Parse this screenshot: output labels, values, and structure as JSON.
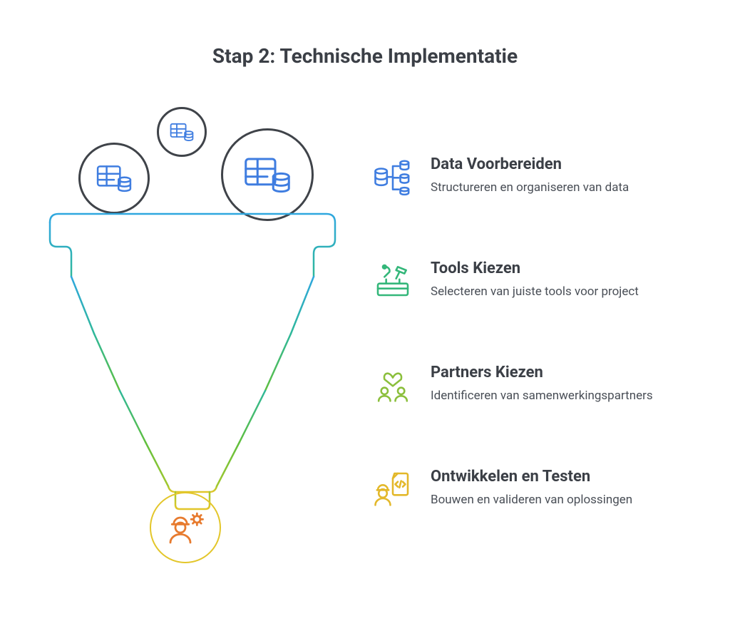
{
  "title": "Stap 2: Technische Implementatie",
  "colors": {
    "blue": "#2fa7df",
    "teal": "#2fb89a",
    "green": "#5fbf3e",
    "lime": "#a3c82f",
    "yellow": "#e3c62a",
    "iconBlue": "#3f7de0",
    "iconGreen": "#34b77a",
    "iconLime": "#8bbf3c",
    "iconYellow": "#e3b82a",
    "iconOrange": "#e77b2f",
    "text": "#3b3f46"
  },
  "diagram": {
    "type": "funnel",
    "stages_count": 5,
    "top_inputs_icon": "table-database-icon",
    "output_icon": "engineer-gear-icon"
  },
  "steps": [
    {
      "icon": "database-hierarchy-icon",
      "title": "Data Voorbereiden",
      "desc": "Structureren en organiseren van data"
    },
    {
      "icon": "toolbox-icon",
      "title": "Tools Kiezen",
      "desc": "Selecteren van juiste tools voor project"
    },
    {
      "icon": "partners-heart-icon",
      "title": "Partners Kiezen",
      "desc": "Identificeren van samenwerkingspartners"
    },
    {
      "icon": "engineer-code-icon",
      "title": "Ontwikkelen en Testen",
      "desc": "Bouwen en valideren van oplossingen"
    }
  ]
}
